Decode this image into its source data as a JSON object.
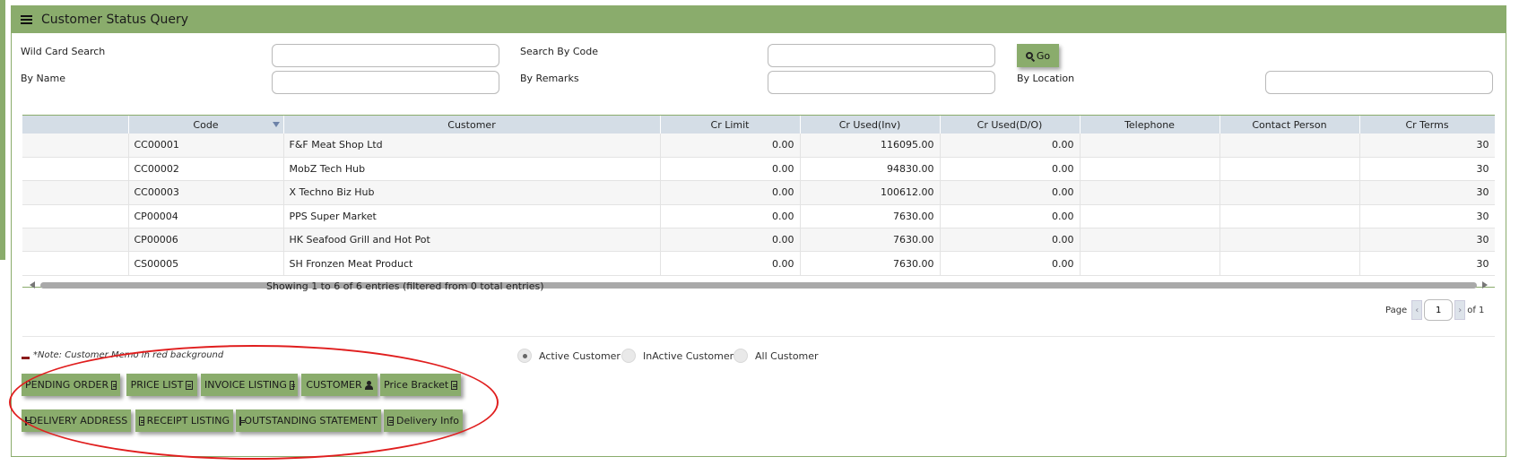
{
  "header": {
    "title": "Customer Status Query"
  },
  "filters": {
    "wildcard_label": "Wild Card Search",
    "code_label": "Search By Code",
    "name_label": "By Name",
    "remarks_label": "By Remarks",
    "location_label": "By Location",
    "go_label": "Go"
  },
  "table": {
    "columns": [
      "",
      "Code",
      "Customer",
      "Cr Limit",
      "Cr Used(Inv)",
      "Cr Used(D/O)",
      "Telephone",
      "Contact Person",
      "Cr Terms"
    ],
    "rows": [
      [
        "",
        "CC00001",
        "F&F Meat Shop Ltd",
        "0.00",
        "116095.00",
        "0.00",
        "",
        "",
        "30"
      ],
      [
        "",
        "CC00002",
        "MobZ Tech Hub",
        "0.00",
        "94830.00",
        "0.00",
        "",
        "",
        "30"
      ],
      [
        "",
        "CC00003",
        "X Techno Biz Hub",
        "0.00",
        "100612.00",
        "0.00",
        "",
        "",
        "30"
      ],
      [
        "",
        "CP00004",
        "PPS Super Market",
        "0.00",
        "7630.00",
        "0.00",
        "",
        "",
        "30"
      ],
      [
        "",
        "CP00006",
        "HK Seafood Grill and Hot Pot",
        "0.00",
        "7630.00",
        "0.00",
        "",
        "",
        "30"
      ],
      [
        "",
        "CS00005",
        "SH Fronzen Meat Product",
        "0.00",
        "7630.00",
        "0.00",
        "",
        "",
        "30"
      ]
    ]
  },
  "info": {
    "text": "Showing 1 to 6 of 6 entries (filtered from 0 total entries)"
  },
  "pager": {
    "page_label": "Page",
    "page_value": "1",
    "of_label": "of 1",
    "prev": "‹",
    "next": "›"
  },
  "note": "*Note: Customer Memo in red background",
  "status_filter": {
    "active": "Active Customer",
    "inactive": "InActive Customer",
    "all": "All Customer",
    "selected": "Active Customer"
  },
  "buttons": {
    "pending_order": "PENDING ORDER",
    "price_list": "PRICE LIST",
    "invoice_listing": "INVOICE LISTING",
    "customer": "CUSTOMER",
    "price_bracket": "Price Bracket",
    "delivery_address": "DELIVERY ADDRESS",
    "receipt_listing": "RECEIPT LISTING",
    "outstanding_statement": "OUTSTANDING STATEMENT",
    "delivery_info": "Delivery Info"
  },
  "colors": {
    "accent": "#8aac6c",
    "header_row": "#d4dde6",
    "annotation": "#e01e1e"
  }
}
